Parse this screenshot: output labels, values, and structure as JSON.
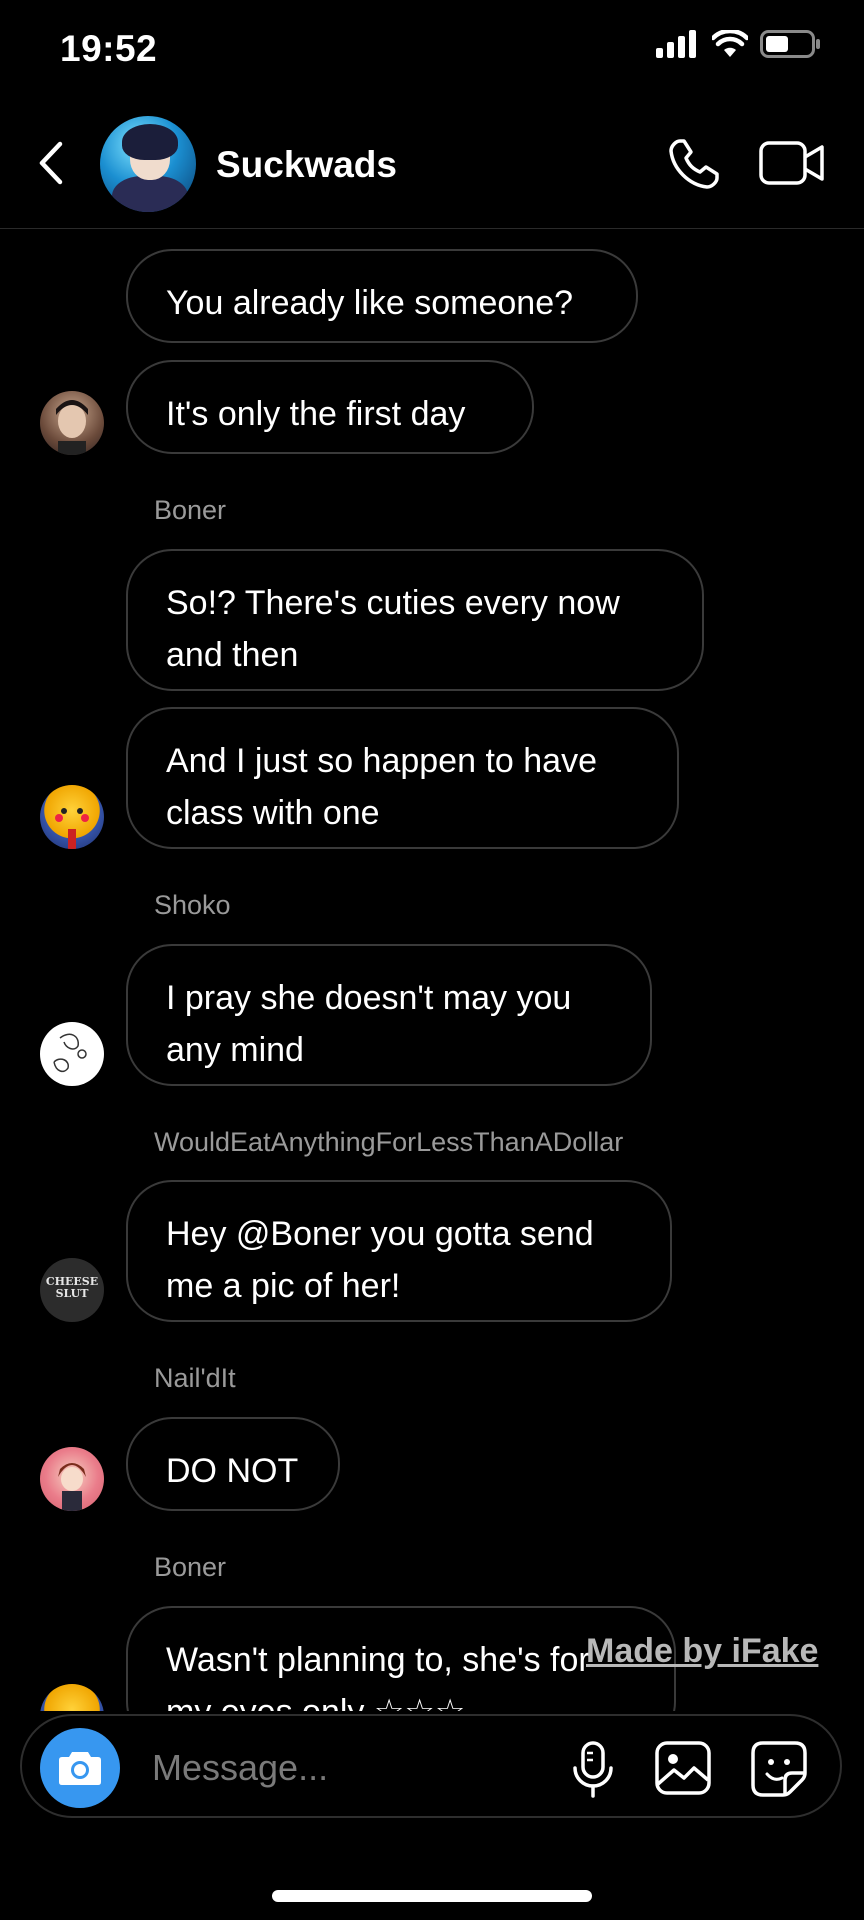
{
  "status_bar": {
    "time": "19:52"
  },
  "header": {
    "title": "Suckwads",
    "back_icon": "chevron-left-icon",
    "call_icon": "phone-icon",
    "video_icon": "video-camera-icon"
  },
  "messages": [
    {
      "sender": "",
      "text": "You already like someone?",
      "avatar": ""
    },
    {
      "sender": "",
      "text": "It's only the first day",
      "avatar": "avatar-1"
    },
    {
      "sender": "Boner",
      "text": "So!? There's cuties every now and then",
      "avatar": ""
    },
    {
      "sender": "",
      "text": "And I just so happen to have class with one",
      "avatar": "avatar-2"
    },
    {
      "sender": "Shoko",
      "text": "I pray she doesn't may you any mind",
      "avatar": "avatar-3"
    },
    {
      "sender": "WouldEatAnythingForLessThanADollar",
      "text": "Hey @Boner you gotta send me a pic of her!",
      "avatar": "avatar-4"
    },
    {
      "sender": "Nail'dIt",
      "text": "DO NOT",
      "avatar": "avatar-5"
    },
    {
      "sender": "Boner",
      "text": "Wasn't planning to, she's for my eyes only ☆☆☆",
      "avatar": "avatar-2"
    }
  ],
  "avatar_text": {
    "cheese": "CHEESE SLUT"
  },
  "watermark": "Made by iFake",
  "composer": {
    "placeholder": "Message...",
    "camera_icon": "camera-icon",
    "mic_icon": "microphone-icon",
    "gallery_icon": "image-icon",
    "sticker_icon": "sticker-icon"
  },
  "colors": {
    "background": "#000000",
    "accent": "#3797f0",
    "bubble_border": "#3a3a3a",
    "secondary_text": "#9a9a9a"
  }
}
